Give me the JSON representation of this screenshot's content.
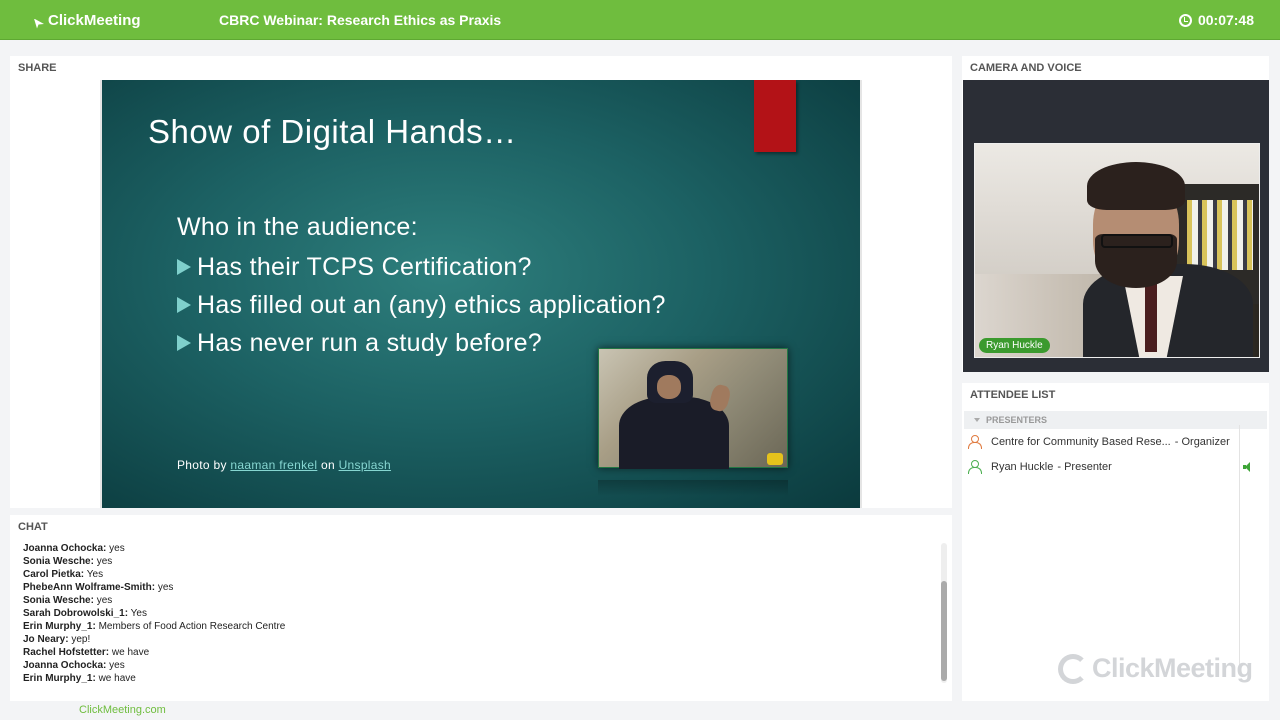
{
  "header": {
    "logo_text": "ClickMeeting",
    "title": "CBRC Webinar: Research Ethics as Praxis",
    "timer": "00:07:48"
  },
  "share": {
    "label": "SHARE",
    "slide": {
      "title": "Show of Digital Hands…",
      "intro": "Who in the audience:",
      "bullets": [
        "Has their TCPS Certification?",
        "Has filled out an (any) ethics application?",
        "Has never run a study before?"
      ],
      "credit_prefix": "Photo by",
      "credit_author": "naaman frenkel",
      "credit_mid": "on",
      "credit_site": "Unsplash"
    }
  },
  "camera": {
    "label": "CAMERA AND VOICE",
    "presenter_name": "Ryan Huckle"
  },
  "attendees": {
    "label": "ATTENDEE LIST",
    "section": "PRESENTERS",
    "items": [
      {
        "name": "Centre for Community Based Rese...",
        "role": "- Organizer",
        "icon_color": "#e07a3f"
      },
      {
        "name": "Ryan Huckle",
        "role": "- Presenter",
        "icon_color": "#4caf50",
        "speaking": true
      }
    ],
    "watermark": "ClickMeeting"
  },
  "chat": {
    "label": "CHAT",
    "messages": [
      {
        "author": "Joanna  Ochocka:",
        "text": "yes"
      },
      {
        "author": "Sonia Wesche:",
        "text": "yes"
      },
      {
        "author": "Carol Pietka:",
        "text": "Yes"
      },
      {
        "author": "PhebeAnn Wolframe-Smith:",
        "text": "yes"
      },
      {
        "author": "Sonia Wesche:",
        "text": "yes"
      },
      {
        "author": "Sarah Dobrowolski_1:",
        "text": "Yes"
      },
      {
        "author": "Erin  Murphy_1:",
        "text": "Members of Food Action Research Centre"
      },
      {
        "author": "Jo Neary:",
        "text": "yep!"
      },
      {
        "author": "Rachel Hofstetter:",
        "text": "we have"
      },
      {
        "author": "Joanna  Ochocka:",
        "text": "yes"
      },
      {
        "author": "Erin  Murphy_1:",
        "text": "we have"
      }
    ]
  },
  "footer": {
    "link": "ClickMeeting.com"
  },
  "colors": {
    "brand_green": "#6fbd3e",
    "slide_teal": "#1c6163",
    "accent_red": "#b31217"
  }
}
